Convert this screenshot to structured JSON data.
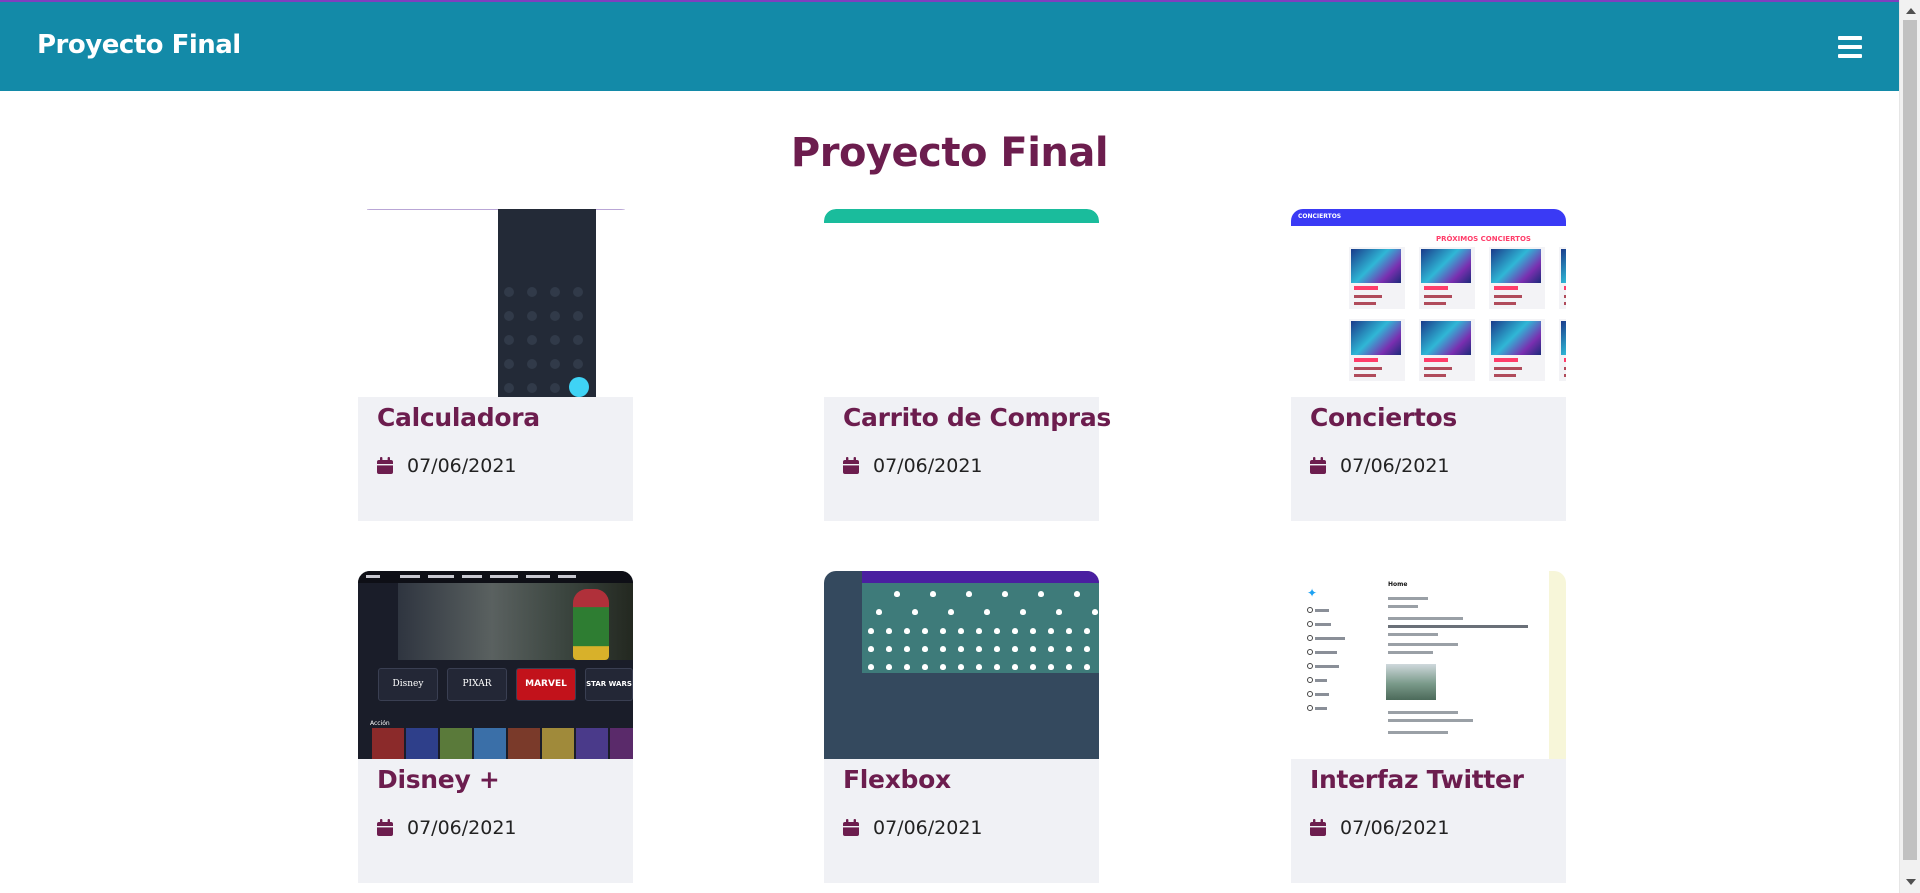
{
  "navbar": {
    "brand": "Proyecto Final",
    "menu_icon": "hamburger-menu-icon"
  },
  "heading": "Proyecto Final",
  "cards": [
    {
      "title": "Calculadora",
      "date": "07/06/2021"
    },
    {
      "title": "Carrito de Compras",
      "date": "07/06/2021"
    },
    {
      "title": "Conciertos",
      "date": "07/06/2021"
    },
    {
      "title": "Disney +",
      "date": "07/06/2021"
    },
    {
      "title": "Flexbox",
      "date": "07/06/2021"
    },
    {
      "title": "Interfaz Twitter",
      "date": "07/06/2021"
    }
  ],
  "thumbnails": {
    "conciertos": {
      "bar_text": "CONCIERTOS",
      "heading": "PRÓXIMOS CONCIERTOS"
    },
    "disney": {
      "brands": [
        "Disney",
        "PIXAR",
        "MARVEL",
        "STAR WARS"
      ],
      "row_label": "Acción"
    },
    "twitter": {
      "home": "Home"
    }
  },
  "colors": {
    "navbar": "#138aa8",
    "title": "#6c1d4e",
    "card_body": "#f0f1f5"
  }
}
